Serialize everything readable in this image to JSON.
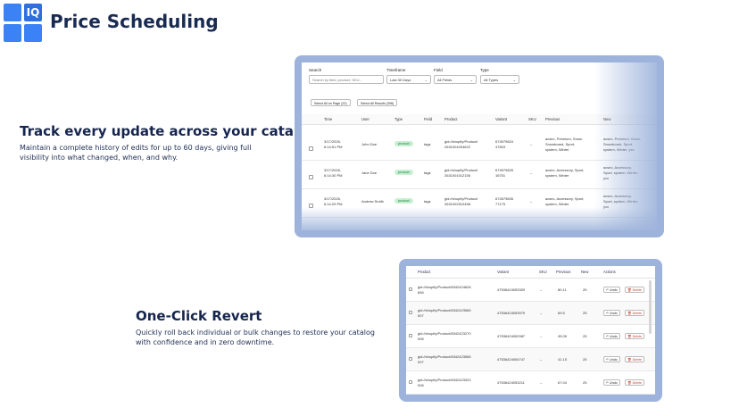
{
  "app": {
    "title": "Price Scheduling",
    "logo_text": "IQ"
  },
  "feature1": {
    "title": "Track every update across your catalog",
    "desc_line1": "Maintain a complete history of edits for up to 60 days, giving full",
    "desc_line2": "visibility into what changed, when, and why."
  },
  "feature2": {
    "title": "One-Click Revert",
    "desc_line1": "Quickly roll back individual or bulk changes to restore your catalog",
    "desc_line2": "with confidence and in zero downtime."
  },
  "history": {
    "filters": {
      "search_label": "Search",
      "search_placeholder": "Search by field, product, SKU...",
      "timeframe_label": "Timeframe",
      "timeframe_value": "Last 30 Days",
      "field_label": "Field",
      "field_value": "All Fields",
      "type_label": "Type",
      "type_value": "All Types"
    },
    "select_page_btn": "Select All on Page (22)",
    "select_results_btn": "Select All Results (396)",
    "columns": [
      "Time",
      "User",
      "Type",
      "Field",
      "Product",
      "Variant",
      "SKU",
      "Previous",
      "New"
    ],
    "rows": [
      {
        "time1": "3/17/2026,",
        "time2": "6:14:51 PM",
        "user": "John Doe",
        "type": "product",
        "field": "tags",
        "product1": "gid://shopify/Product/",
        "product2": "2631004204622",
        "variant1": "674579824",
        "variant2": "47603",
        "sku": "–",
        "prev1": "acsec, Premium, Snow,",
        "prev2": "Snowboard, Sport,",
        "prev3": "system, Winter",
        "new1": "acsec, Premium, Snow,",
        "new2": "Snowboard, Sport,",
        "new3": "system, Winter, yxx"
      },
      {
        "time1": "3/17/2026,",
        "time2": "6:14:30 PM",
        "user": "Jane Doe",
        "type": "product",
        "field": "tags",
        "product1": "gid://shopify/Product/",
        "product2": "2631001012155",
        "variant1": "674579825",
        "variant2": "16751",
        "sku": "–",
        "prev1": "acsec, Accessory, Sport,",
        "prev2": "system, Winter",
        "prev3": "",
        "new1": "acsec, Accessory,",
        "new2": "Sport, system, Winter,",
        "new3": "yxx"
      },
      {
        "time1": "3/17/2026,",
        "time2": "6:14:29 PM",
        "user": "Andrew Smith",
        "type": "product",
        "field": "tags",
        "product1": "gid://shopify/Product/",
        "product2": "2631002510458",
        "variant1": "674579826",
        "variant2": "77175",
        "sku": "–",
        "prev1": "acsec, Accessory, Sport,",
        "prev2": "system, Winter",
        "prev3": "",
        "new1": "acsec, Accessory,",
        "new2": "Sport, system, Winter,",
        "new3": "yxx"
      }
    ]
  },
  "revert": {
    "columns": [
      "Product",
      "Variant",
      "SKU",
      "Previous",
      "New",
      "Actions"
    ],
    "undo_label": "Undo",
    "delete_label": "Delete",
    "rows": [
      {
        "product1": "gid://shopify/Product/8342424626",
        "product2": "846",
        "variant": "47536424053309",
        "sku": "–",
        "prev": "80.11",
        "new": "25"
      },
      {
        "product1": "gid://shopify/Product/8342423565",
        "product2": "007",
        "variant": "47536424053979",
        "sku": "–",
        "prev": "69.5",
        "new": "25"
      },
      {
        "product1": "gid://shopify/Product/8342423270",
        "product2": "006",
        "variant": "47536424052987",
        "sku": "–",
        "prev": "45.05",
        "new": "25"
      },
      {
        "product1": "gid://shopify/Product/8342423565",
        "product2": "007",
        "variant": "47536424054747",
        "sku": "–",
        "prev": "41.15",
        "new": "25"
      },
      {
        "product1": "gid://shopify/Product/8342423322",
        "product2": "006",
        "variant": "47536424053211",
        "sku": "–",
        "prev": "67.04",
        "new": "25"
      }
    ]
  }
}
